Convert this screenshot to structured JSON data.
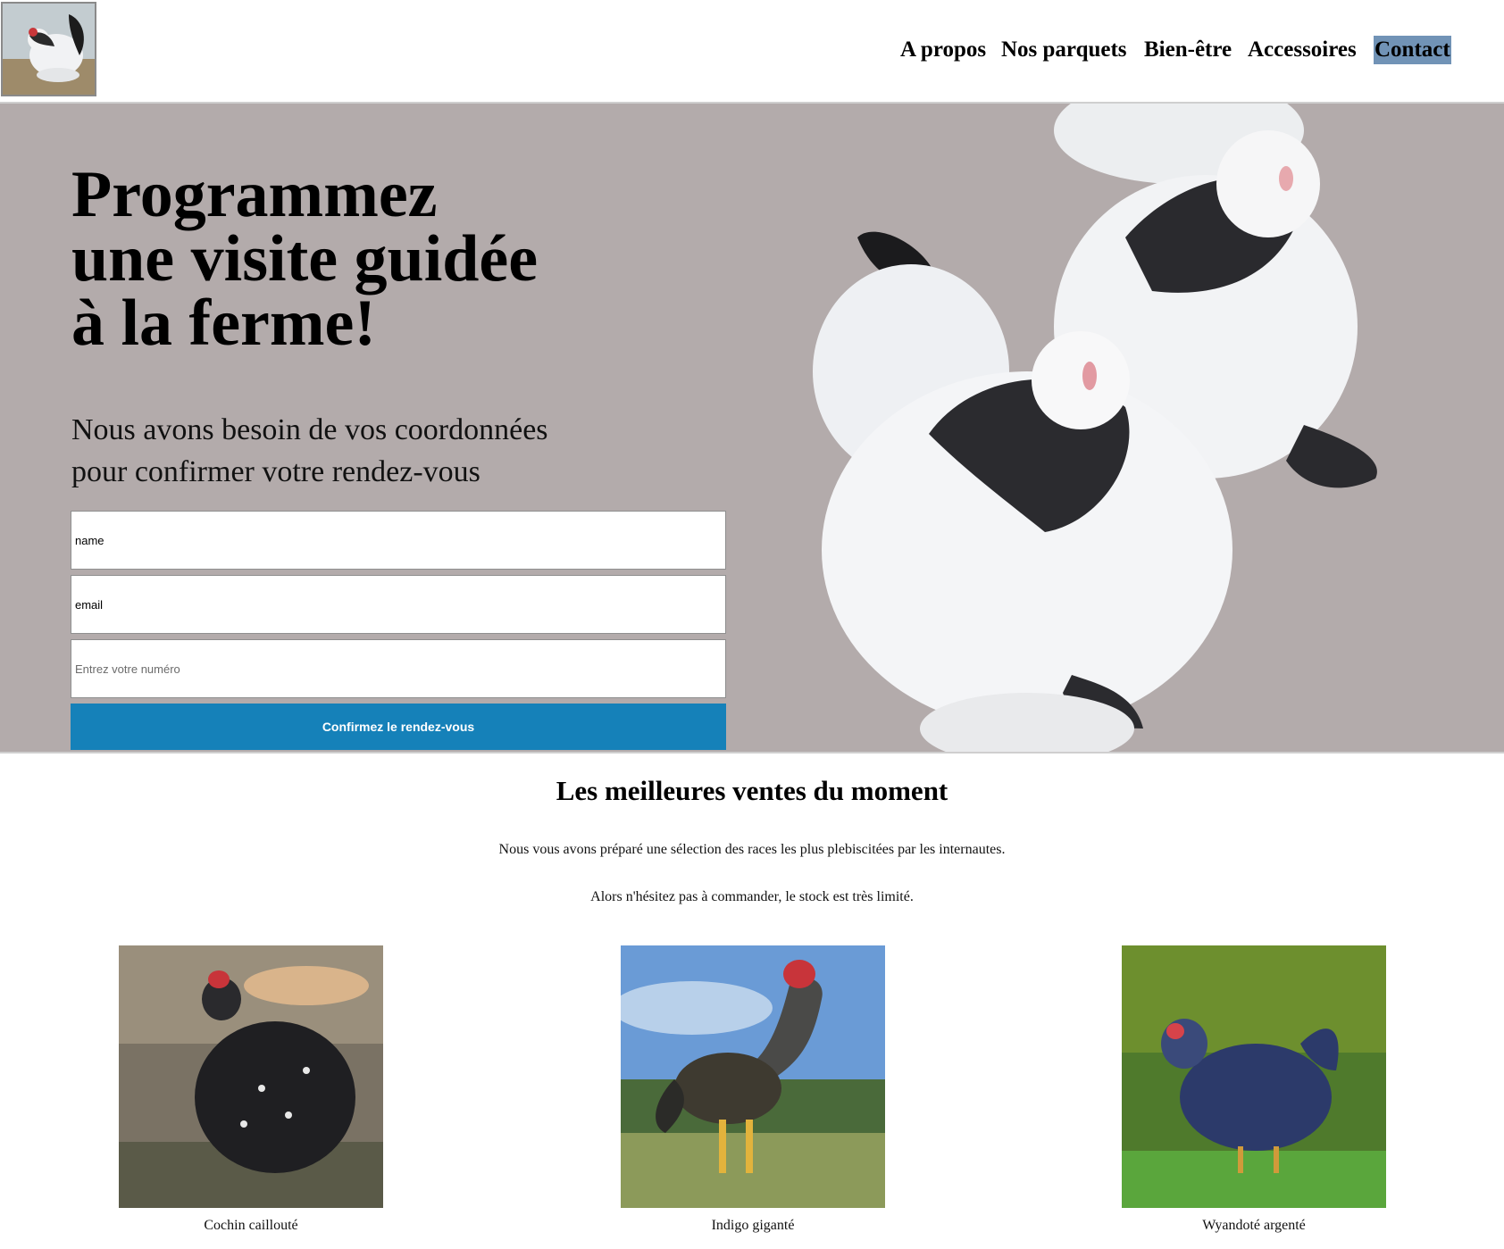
{
  "header": {
    "logo_icon": "hen-photo-logo",
    "nav": [
      {
        "label": "A propos"
      },
      {
        "label": "Nos parquets"
      },
      {
        "label": "Bien-être"
      },
      {
        "label": "Accessoires"
      },
      {
        "label": "Contact",
        "active": true
      }
    ]
  },
  "hero": {
    "title_lines": [
      "Programmez",
      "une visite guidée",
      "à la ferme!"
    ],
    "subtitle_lines": [
      "Nous avons besoin de vos coordonnées",
      "pour confirmer votre rendez-vous"
    ],
    "form": {
      "name_value": "name",
      "email_value": "email",
      "phone_placeholder": "Entrez votre numéro",
      "submit_label": "Confirmez le rendez-vous"
    },
    "image": "two-brahma-hens-photo"
  },
  "best_sellers": {
    "title": "Les meilleures ventes du moment",
    "text_1": "Nous vous avons préparé une sélection des races les plus plebiscitées par les internautes.",
    "text_2": "Alors n'hésitez pas à commander, le stock est très limité.",
    "products": [
      {
        "name": "Cochin caillouté",
        "image": "cochin-hen-photo"
      },
      {
        "name": "Indigo giganté",
        "image": "indigo-rooster-photo"
      },
      {
        "name": "Wyandoté argenté",
        "image": "wyandotte-hen-photo"
      }
    ]
  },
  "colors": {
    "hero_background": "#b3abab",
    "button": "#1581b9",
    "nav_active_highlight": "#7193b6"
  }
}
